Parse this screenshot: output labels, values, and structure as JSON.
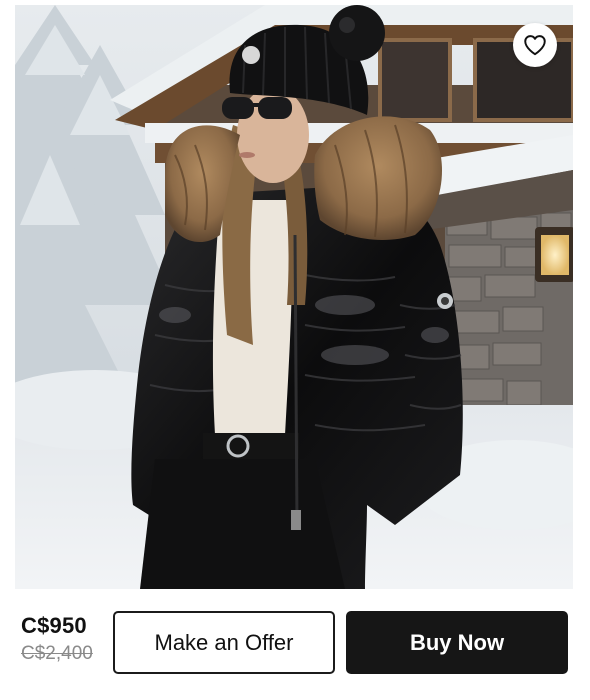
{
  "listing": {
    "image_alt": "Woman wearing a black glossy puffer jacket with a fur-trimmed hood and a black pom-pom beanie in front of a snowy chalet",
    "favorite_icon": "heart-outline-icon"
  },
  "purchase_bar": {
    "price": "C$950",
    "original_price": "C$2,400",
    "offer_label": "Make an Offer",
    "buy_label": "Buy Now"
  },
  "colors": {
    "primary_button_bg": "#161616",
    "primary_button_text": "#ffffff",
    "secondary_button_border": "#1b1b1b",
    "original_price_text": "#8a8a8a"
  }
}
